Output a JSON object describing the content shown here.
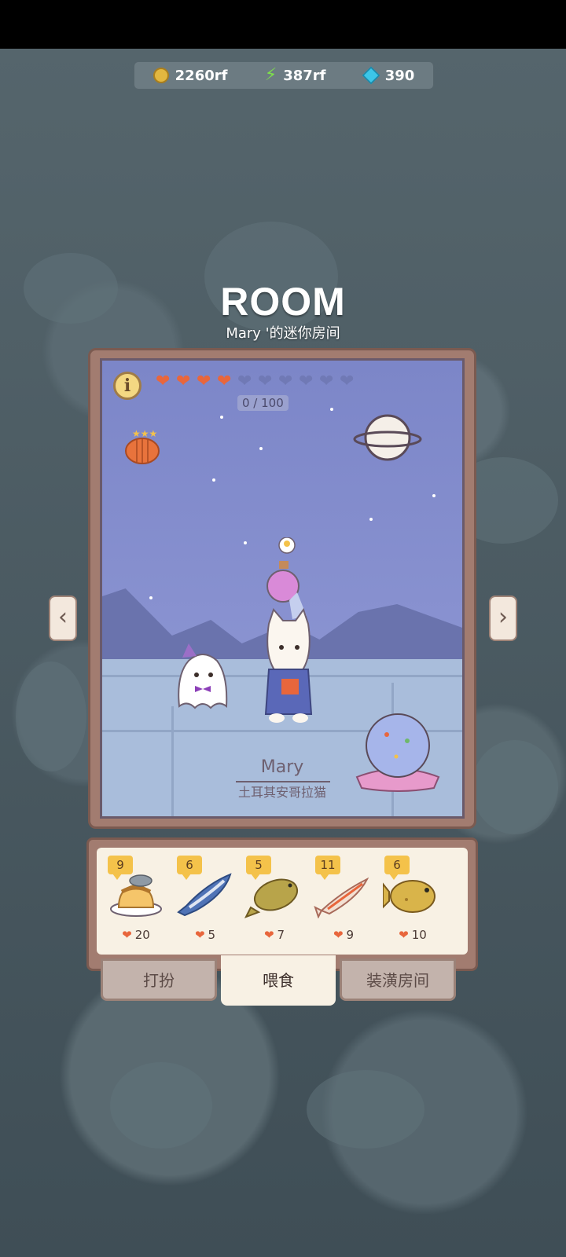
{
  "resources": {
    "coins": "2260rf",
    "energy": "387rf",
    "gems": "390"
  },
  "title": "ROOM",
  "subtitle": "Mary '的迷你房间",
  "room": {
    "hearts_filled": 4,
    "hearts_total": 10,
    "progress": "0 / 100",
    "character_name": "Mary",
    "character_breed": "土耳其安哥拉猫"
  },
  "food_items": [
    {
      "count": "9",
      "love": "20",
      "icon": "pudding-icon"
    },
    {
      "count": "6",
      "love": "5",
      "icon": "tuna-icon"
    },
    {
      "count": "5",
      "love": "7",
      "icon": "carp-icon"
    },
    {
      "count": "11",
      "love": "9",
      "icon": "small-fish-icon"
    },
    {
      "count": "6",
      "love": "10",
      "icon": "flounder-icon"
    }
  ],
  "tabs": {
    "dress_up": "打扮",
    "feed": "喂食",
    "decorate": "装潢房间"
  },
  "colors": {
    "heart_full": "#e8663c",
    "heart_empty": "#7079b5",
    "frame": "#a27c70"
  }
}
